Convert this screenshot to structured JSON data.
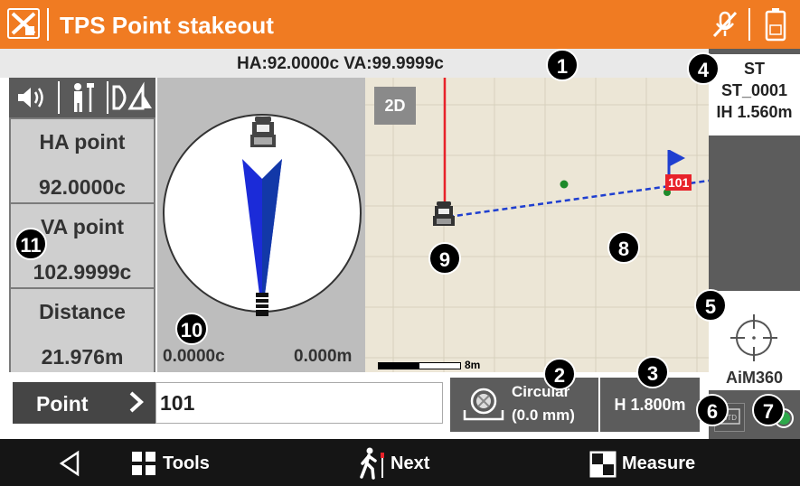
{
  "header": {
    "title": "TPS Point stakeout",
    "logo_icon": "app-logo-icon",
    "mute_icon": "mic-muted-icon",
    "battery_icon": "battery-icon"
  },
  "status": {
    "angles": "HA:92.0000c  VA:99.9999c"
  },
  "left_panel": {
    "icons": [
      "speaker-icon",
      "surveyor-icon",
      "face-change-icon"
    ],
    "ha_label": "HA point",
    "ha_value": "92.0000c",
    "va_label": "VA point",
    "va_value": "102.9999c",
    "dist_label": "Distance",
    "dist_value": "21.976m"
  },
  "compass": {
    "angle_readout": "0.0000c",
    "dist_readout": "0.000m"
  },
  "map": {
    "mode_button": "2D",
    "point_flag": "101",
    "scale_label": "8m"
  },
  "station": {
    "label": "ST",
    "name": "ST_0001",
    "ih": "IH 1.560m"
  },
  "aim": {
    "label": "AiM360"
  },
  "point_row": {
    "label": "Point",
    "value": "101"
  },
  "prism": {
    "type": "Circular",
    "offset": "(0.0 mm)"
  },
  "height": {
    "label": "H 1.800m"
  },
  "bottom_nav": {
    "tools": "Tools",
    "next": "Next",
    "measure": "Measure"
  },
  "callouts": [
    "1",
    "2",
    "3",
    "4",
    "5",
    "6",
    "7",
    "8",
    "9",
    "10",
    "11"
  ],
  "colors": {
    "accent": "#f07b22",
    "panel": "#5c5c5c",
    "map_bg": "#ece6d6",
    "target_flag": "#e8222a"
  }
}
